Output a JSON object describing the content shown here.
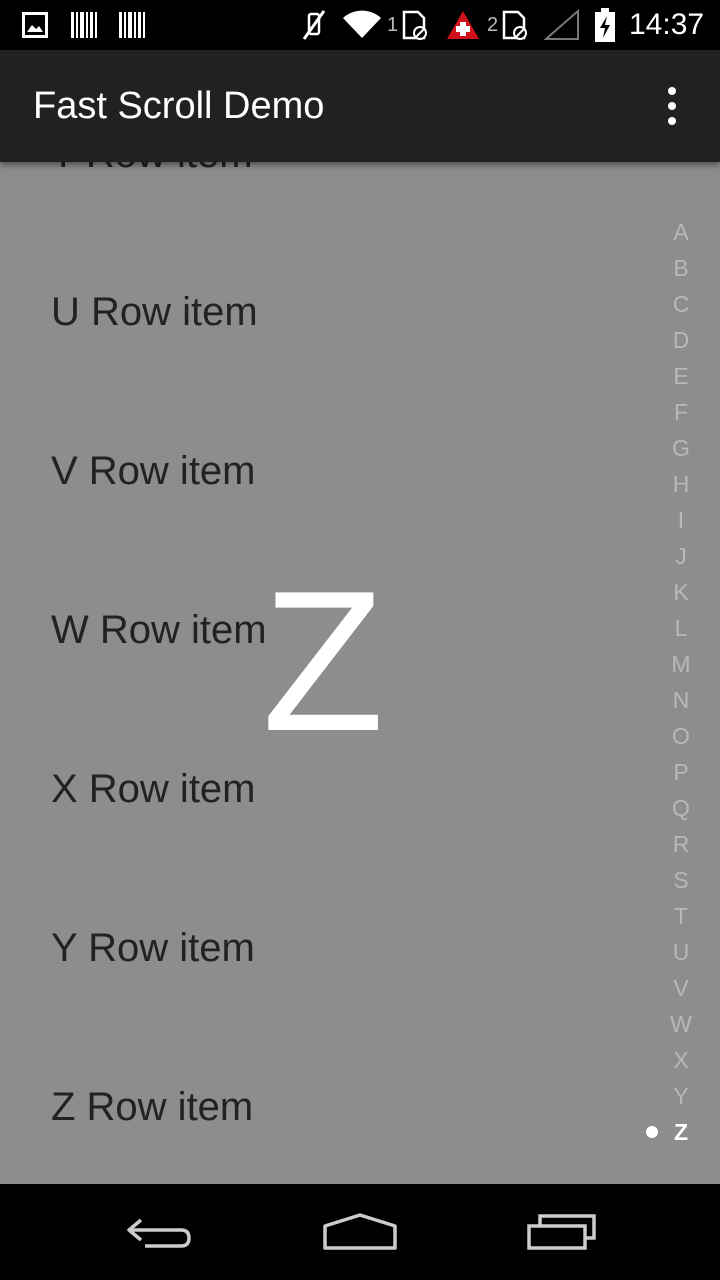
{
  "status_bar": {
    "time": "14:37",
    "sim1_label": "1",
    "sim2_label": "2",
    "icons": [
      "image-icon",
      "barcode-icon",
      "barcode-icon",
      "mute-icon",
      "wifi-icon",
      "sim-blocked-icon",
      "alert-icon",
      "sim-blocked-icon",
      "no-signal-icon",
      "battery-charging-icon"
    ]
  },
  "app_bar": {
    "title": "Fast Scroll Demo",
    "menu_icon": "overflow-menu-icon"
  },
  "list": {
    "partial_row": "T Row item",
    "rows": [
      "U Row item",
      "V Row item",
      "W Row item",
      "X Row item",
      "Y Row item",
      "Z Row item"
    ]
  },
  "fast_scroll": {
    "overlay_letter": "Z",
    "index": [
      "A",
      "B",
      "C",
      "D",
      "E",
      "F",
      "G",
      "H",
      "I",
      "J",
      "K",
      "L",
      "M",
      "N",
      "O",
      "P",
      "Q",
      "R",
      "S",
      "T",
      "U",
      "V",
      "W",
      "X",
      "Y",
      "Z"
    ],
    "active_index": "Z"
  },
  "nav_bar": {
    "icons": [
      "back-icon",
      "home-icon",
      "recents-icon"
    ]
  },
  "colors": {
    "app_bar": "#212121",
    "list_background": "#8d8d8d",
    "row_text": "#222222",
    "index_text": "#b8b8b8",
    "active_index": "#ffffff"
  }
}
